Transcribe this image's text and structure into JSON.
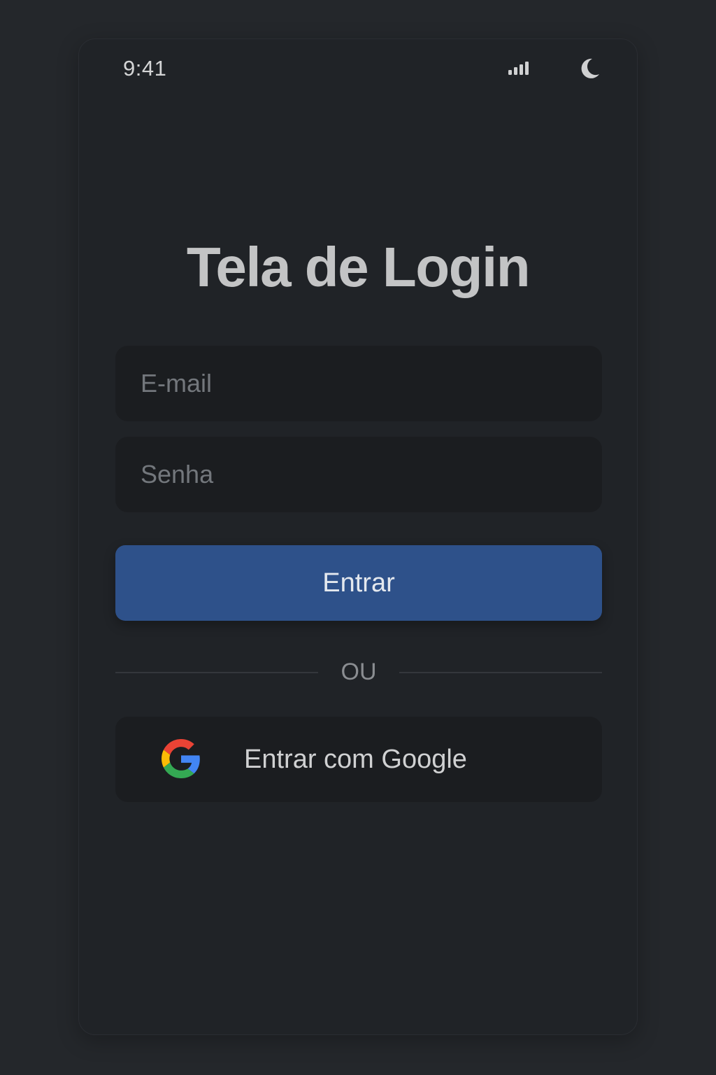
{
  "status_bar": {
    "time": "9:41",
    "signal_icon": "cellular-signal-icon",
    "theme_icon": "moon-icon"
  },
  "screen": {
    "title": "Tela de Login"
  },
  "form": {
    "email_placeholder": "E-mail",
    "password_placeholder": "Senha",
    "submit_label": "Entrar"
  },
  "divider": {
    "label": "OU"
  },
  "social": {
    "google_label": "Entrar com Google",
    "google_icon": "google-icon"
  },
  "colors": {
    "background": "#24272b",
    "surface": "#202327",
    "field": "#1b1d20",
    "primary": "#2e518a",
    "google_blue": "#4285F4",
    "google_red": "#EA4335",
    "google_yellow": "#FBBC05",
    "google_green": "#34A853"
  }
}
